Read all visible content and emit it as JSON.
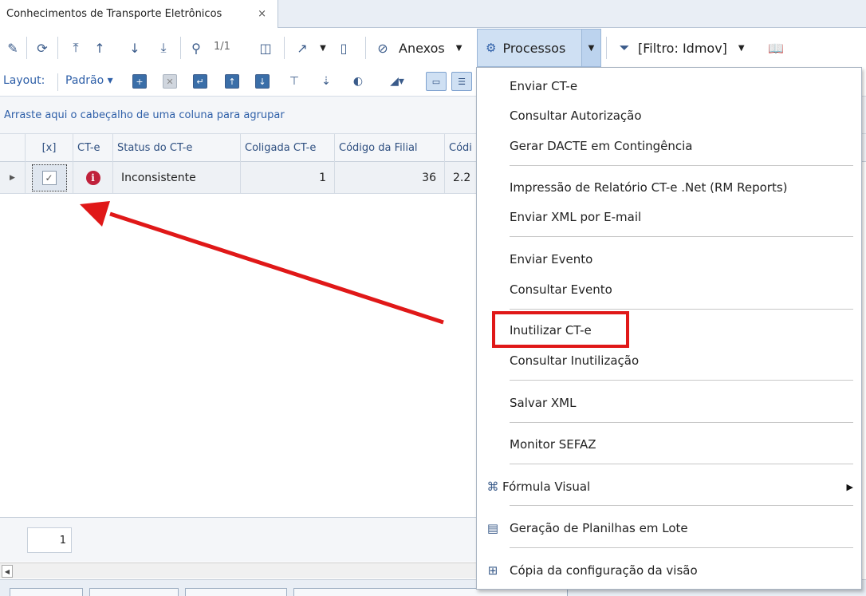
{
  "tab": {
    "title": "Conhecimentos de Transporte Eletrônicos",
    "close": "×"
  },
  "toolbar": {
    "page_label": "1/1",
    "anexos_label": "Anexos",
    "processos_label": "Processos",
    "filtro_label": "[Filtro: Idmov]"
  },
  "toolbar2": {
    "layout_label": "Layout:",
    "padrao_label": "Padrão ▾"
  },
  "group_hint": "Arraste aqui o cabeçalho de uma coluna para agrupar",
  "grid": {
    "columns": [
      "[x]",
      "CT-e",
      "Status do CT-e",
      "Coligada CT-e",
      "Código da Filial",
      "Códi"
    ],
    "row": {
      "checked": "✓",
      "status": "Inconsistente",
      "coligada": "1",
      "filial": "36",
      "codigo": "2.2"
    }
  },
  "footer": {
    "count": "1"
  },
  "menu": {
    "items": [
      "Enviar CT-e",
      "Consultar Autorização",
      "Gerar DACTE em Contingência",
      "Impressão de Relatório CT-e .Net (RM Reports)",
      "Enviar XML por E-mail",
      "Enviar Evento",
      "Consultar Evento",
      "Inutilizar CT-e",
      "Consultar Inutilização",
      "Salvar XML",
      "Monitor SEFAZ",
      "Fórmula Visual",
      "Geração de Planilhas em Lote",
      "Cópia da configuração da visão"
    ]
  },
  "colors": {
    "accent": "#2e5fa8",
    "highlight": "#e01818",
    "menu_selected": "#cfe0f3"
  }
}
